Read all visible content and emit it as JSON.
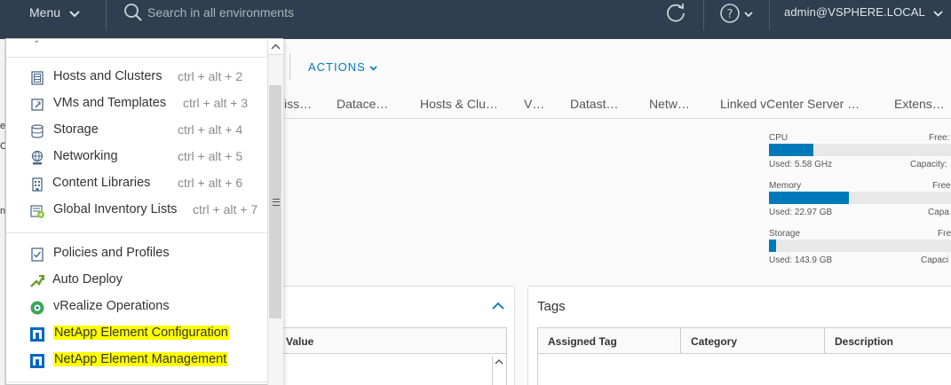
{
  "topbar": {
    "menu_label": "Menu",
    "search_placeholder": "Search in all environments",
    "user": "admin@VSPHERE.LOCAL"
  },
  "left_strip": [
    "er",
    "C",
    "n"
  ],
  "toolbar": {
    "actions_label": "ACTIONS"
  },
  "tabs": [
    "iss…",
    "Datace…",
    "Hosts & Clu…",
    "V…",
    "Datast…",
    "Netw…",
    "Linked vCenter Server …",
    "Extens…"
  ],
  "resources": [
    {
      "label": "CPU",
      "free": "Free:",
      "used": "Used: 5.58 GHz",
      "capacity": "Capacity:",
      "fill_fraction": 0.24
    },
    {
      "label": "Memory",
      "free": "Free",
      "used": "Used: 22.97 GB",
      "capacity": "Capa",
      "fill_fraction": 0.43
    },
    {
      "label": "Storage",
      "free": "Fre",
      "used": "Used: 143.9 GB",
      "capacity": "Capaci",
      "fill_fraction": 0.04
    }
  ],
  "attributes_card": {
    "value_header": "Value"
  },
  "tags_card": {
    "title": "Tags",
    "columns": [
      "Assigned Tag",
      "Category",
      "Description"
    ]
  },
  "menu": {
    "inventory": [
      {
        "label": "Hosts and Clusters",
        "shortcut": "ctrl + alt + 2",
        "icon": "hosts-clusters-icon"
      },
      {
        "label": "VMs and Templates",
        "shortcut": "ctrl + alt + 3",
        "icon": "vms-templates-icon"
      },
      {
        "label": "Storage",
        "shortcut": "ctrl + alt + 4",
        "icon": "storage-icon"
      },
      {
        "label": "Networking",
        "shortcut": "ctrl + alt + 5",
        "icon": "networking-icon"
      },
      {
        "label": "Content Libraries",
        "shortcut": "ctrl + alt + 6",
        "icon": "content-libraries-icon"
      },
      {
        "label": "Global Inventory Lists",
        "shortcut": "ctrl + alt + 7",
        "icon": "global-inventory-icon"
      }
    ],
    "tools": [
      {
        "label": "Policies and Profiles",
        "icon": "policies-icon"
      },
      {
        "label": "Auto Deploy",
        "icon": "auto-deploy-icon"
      },
      {
        "label": "vRealize Operations",
        "icon": "vrealize-icon"
      },
      {
        "label": "NetApp Element Configuration",
        "icon": "netapp-icon",
        "highlighted": true
      },
      {
        "label": "NetApp Element Management",
        "icon": "netapp-icon",
        "highlighted": true
      }
    ]
  },
  "colors": {
    "topbar_bg": "#2e3f4f",
    "accent": "#0079b8",
    "highlight": "#ffff00"
  }
}
